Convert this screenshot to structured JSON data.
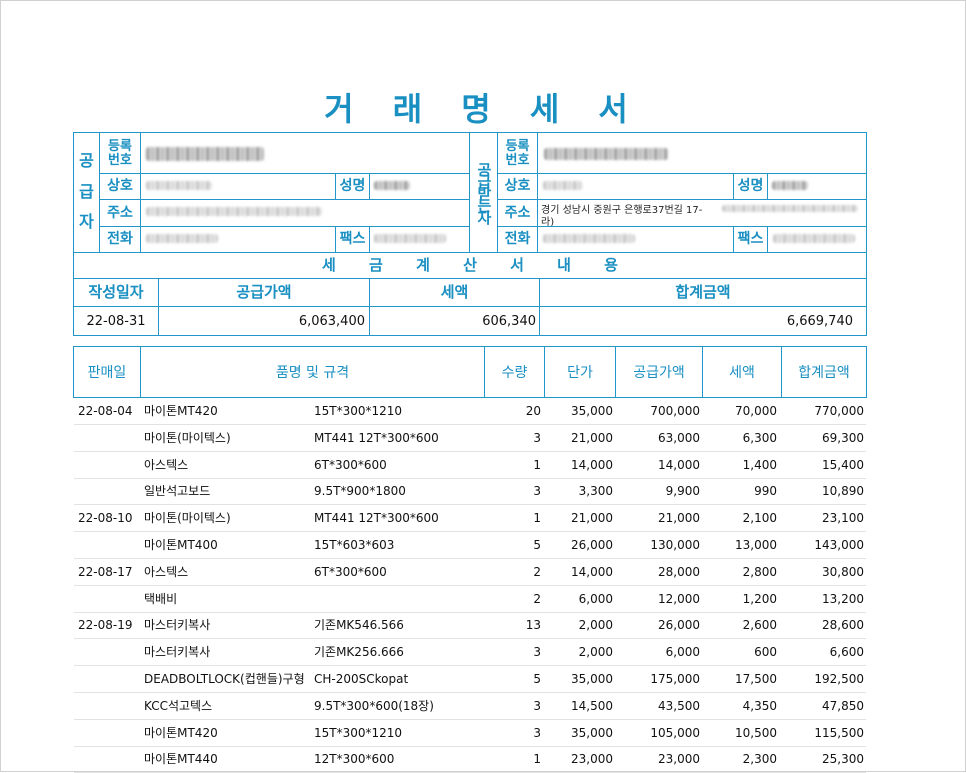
{
  "doc_title": "거 래 명 세 서",
  "supplier": {
    "side_label": "공\n급\n자",
    "reg_label": "등록\n번호",
    "name_label": "상호",
    "rep_label": "성명",
    "addr_label": "주소",
    "tel_label": "전화",
    "fax_label": "팩스"
  },
  "receiver": {
    "side_label": "공급받는자",
    "reg_label": "등록\n번호",
    "name_label": "상호",
    "rep_label": "성명",
    "addr_label": "주소",
    "addr_value": "경기 성남시 중원구 은행로37번길 17-",
    "addr_value_2": "라)",
    "tel_label": "전화",
    "fax_label": "팩스"
  },
  "tax": {
    "section_title": "세 금 계 산 서 내 용",
    "date_label": "작성일자",
    "supply_label": "공급가액",
    "tax_label": "세액",
    "total_label": "합계금액",
    "date": "22-08-31",
    "supply": "6,063,400",
    "tax_amount": "606,340",
    "total": "6,669,740"
  },
  "items_header": {
    "date": "판매일",
    "name": "품명 및 규격",
    "qty": "수량",
    "price": "단가",
    "supply": "공급가액",
    "tax": "세액",
    "total": "합계금액"
  },
  "items": [
    {
      "date": "22-08-04",
      "name": "마이톤MT420",
      "spec": "15T*300*1210",
      "qty": "20",
      "price": "35,000",
      "supply": "700,000",
      "tax": "70,000",
      "total": "770,000"
    },
    {
      "date": "",
      "name": "마이톤(마이텍스)",
      "spec": "MT441 12T*300*600",
      "qty": "3",
      "price": "21,000",
      "supply": "63,000",
      "tax": "6,300",
      "total": "69,300"
    },
    {
      "date": "",
      "name": "아스텍스",
      "spec": "6T*300*600",
      "qty": "1",
      "price": "14,000",
      "supply": "14,000",
      "tax": "1,400",
      "total": "15,400"
    },
    {
      "date": "",
      "name": "일반석고보드",
      "spec": "9.5T*900*1800",
      "qty": "3",
      "price": "3,300",
      "supply": "9,900",
      "tax": "990",
      "total": "10,890"
    },
    {
      "date": "22-08-10",
      "name": "마이톤(마이텍스)",
      "spec": "MT441 12T*300*600",
      "qty": "1",
      "price": "21,000",
      "supply": "21,000",
      "tax": "2,100",
      "total": "23,100"
    },
    {
      "date": "",
      "name": "마이톤MT400",
      "spec": "15T*603*603",
      "qty": "5",
      "price": "26,000",
      "supply": "130,000",
      "tax": "13,000",
      "total": "143,000"
    },
    {
      "date": "22-08-17",
      "name": "아스텍스",
      "spec": "6T*300*600",
      "qty": "2",
      "price": "14,000",
      "supply": "28,000",
      "tax": "2,800",
      "total": "30,800"
    },
    {
      "date": "",
      "name": "택배비",
      "spec": "",
      "qty": "2",
      "price": "6,000",
      "supply": "12,000",
      "tax": "1,200",
      "total": "13,200"
    },
    {
      "date": "22-08-19",
      "name": "마스터키복사",
      "spec": "기존MK546.566",
      "qty": "13",
      "price": "2,000",
      "supply": "26,000",
      "tax": "2,600",
      "total": "28,600"
    },
    {
      "date": "",
      "name": "마스터키복사",
      "spec": "기존MK256.666",
      "qty": "3",
      "price": "2,000",
      "supply": "6,000",
      "tax": "600",
      "total": "6,600"
    },
    {
      "date": "",
      "name": "DEADBOLTLOCK(컵핸들)구형",
      "spec": "CH-200SCkopat",
      "qty": "5",
      "price": "35,000",
      "supply": "175,000",
      "tax": "17,500",
      "total": "192,500"
    },
    {
      "date": "",
      "name": "KCC석고텍스",
      "spec": "9.5T*300*600(18장)",
      "qty": "3",
      "price": "14,500",
      "supply": "43,500",
      "tax": "4,350",
      "total": "47,850"
    },
    {
      "date": "",
      "name": "마이톤MT420",
      "spec": "15T*300*1210",
      "qty": "3",
      "price": "35,000",
      "supply": "105,000",
      "tax": "10,500",
      "total": "115,500"
    },
    {
      "date": "",
      "name": "마이톤MT440",
      "spec": "12T*300*600",
      "qty": "1",
      "price": "23,000",
      "supply": "23,000",
      "tax": "2,300",
      "total": "25,300"
    }
  ]
}
